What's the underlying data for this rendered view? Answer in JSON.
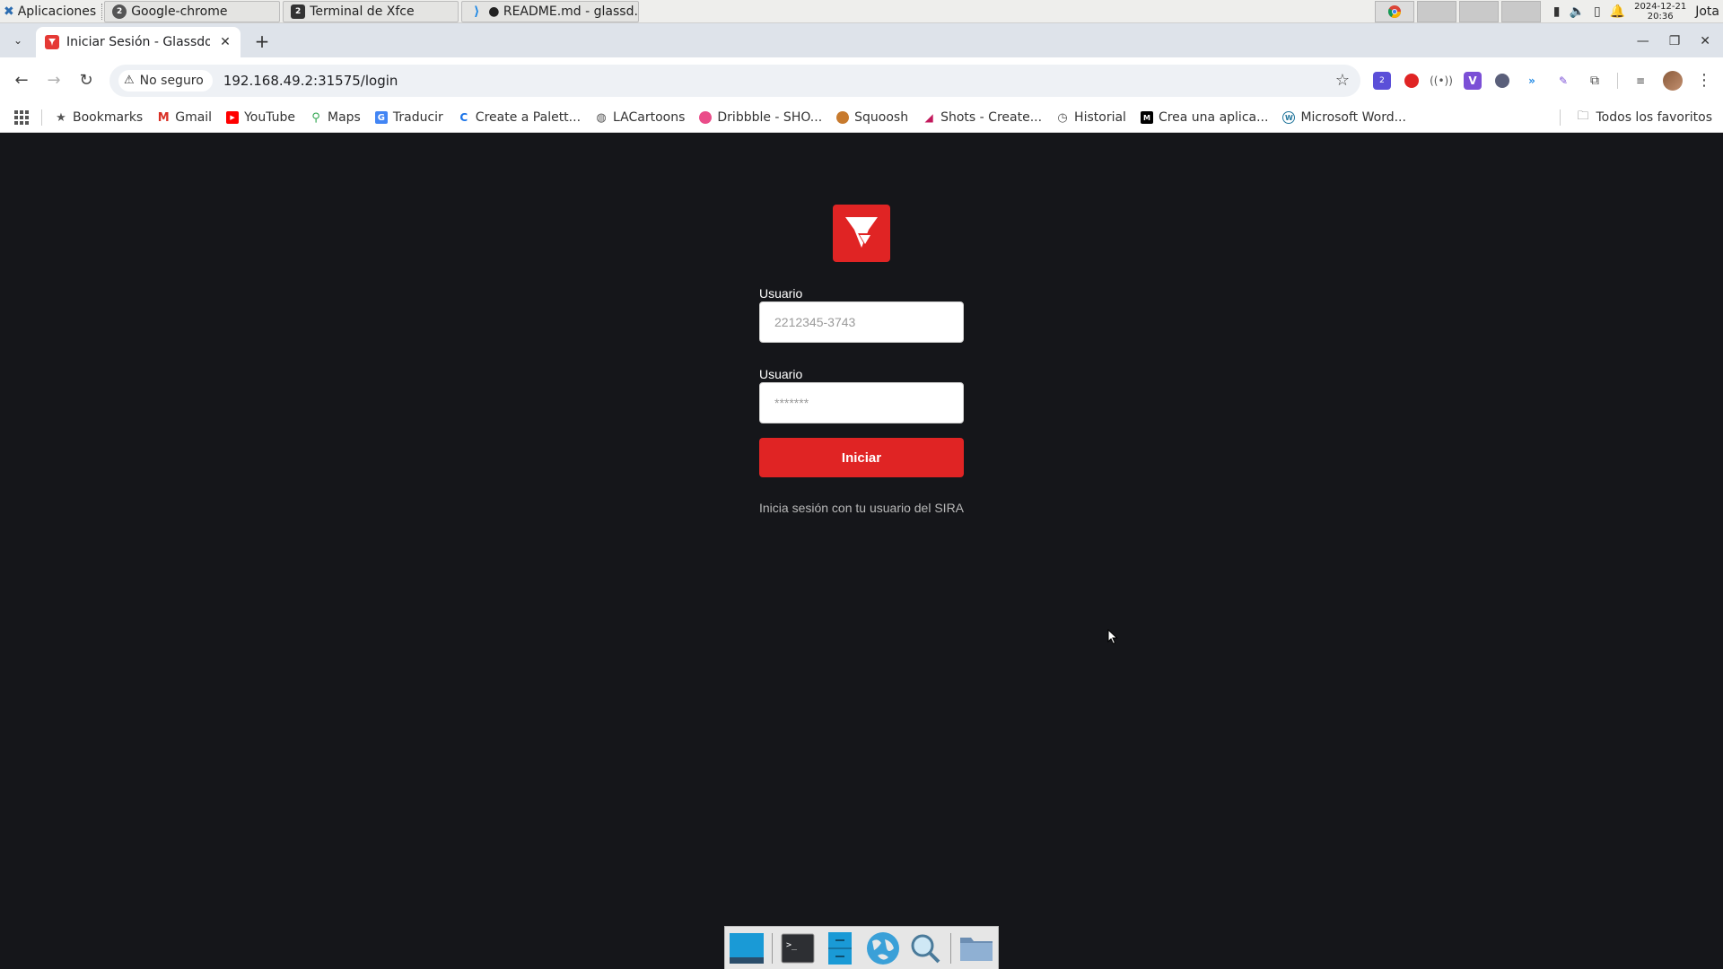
{
  "panel": {
    "apps_label": "Aplicaciones",
    "tasks": [
      {
        "label": "Google-chrome",
        "badge": "2",
        "icon": "chrome-group-icon"
      },
      {
        "label": "Terminal de Xfce",
        "badge": "2",
        "icon": "terminal-group-icon"
      },
      {
        "label": "● README.md - glassd...",
        "icon": "vscode-icon"
      }
    ],
    "clock": {
      "date": "2024-12-21",
      "time": "20:36"
    },
    "user": "Jota"
  },
  "browser": {
    "tab": {
      "title": "Iniciar Sesión - Glassdoor"
    },
    "security_label": "No seguro",
    "url": "192.168.49.2:31575/login",
    "extension_badge": "2",
    "bookmarks": [
      {
        "label": "Bookmarks",
        "icon": "star-icon"
      },
      {
        "label": "Gmail",
        "icon": "gmail-icon"
      },
      {
        "label": "YouTube",
        "icon": "youtube-icon"
      },
      {
        "label": "Maps",
        "icon": "maps-icon"
      },
      {
        "label": "Traducir",
        "icon": "translate-icon"
      },
      {
        "label": "Create a Palett...",
        "icon": "coolors-icon"
      },
      {
        "label": "LACartoons",
        "icon": "globe-icon"
      },
      {
        "label": "Dribbble - SHO...",
        "icon": "dribbble-icon"
      },
      {
        "label": "Squoosh",
        "icon": "squoosh-icon"
      },
      {
        "label": "Shots - Create...",
        "icon": "shots-icon"
      },
      {
        "label": "Historial",
        "icon": "history-icon"
      },
      {
        "label": "Crea una aplica...",
        "icon": "medium-icon"
      },
      {
        "label": "Microsoft Word...",
        "icon": "wordpress-icon"
      }
    ],
    "all_bookmarks_label": "Todos los favoritos"
  },
  "login": {
    "username_label": "Usuario",
    "username_placeholder": "2212345-3743",
    "password_label": "Usuario",
    "password_placeholder": "*******",
    "submit_label": "Iniciar",
    "hint": "Inicia sesión con tu usuario del SIRA"
  },
  "colors": {
    "accent": "#e02424",
    "page_background": "#15161a"
  }
}
